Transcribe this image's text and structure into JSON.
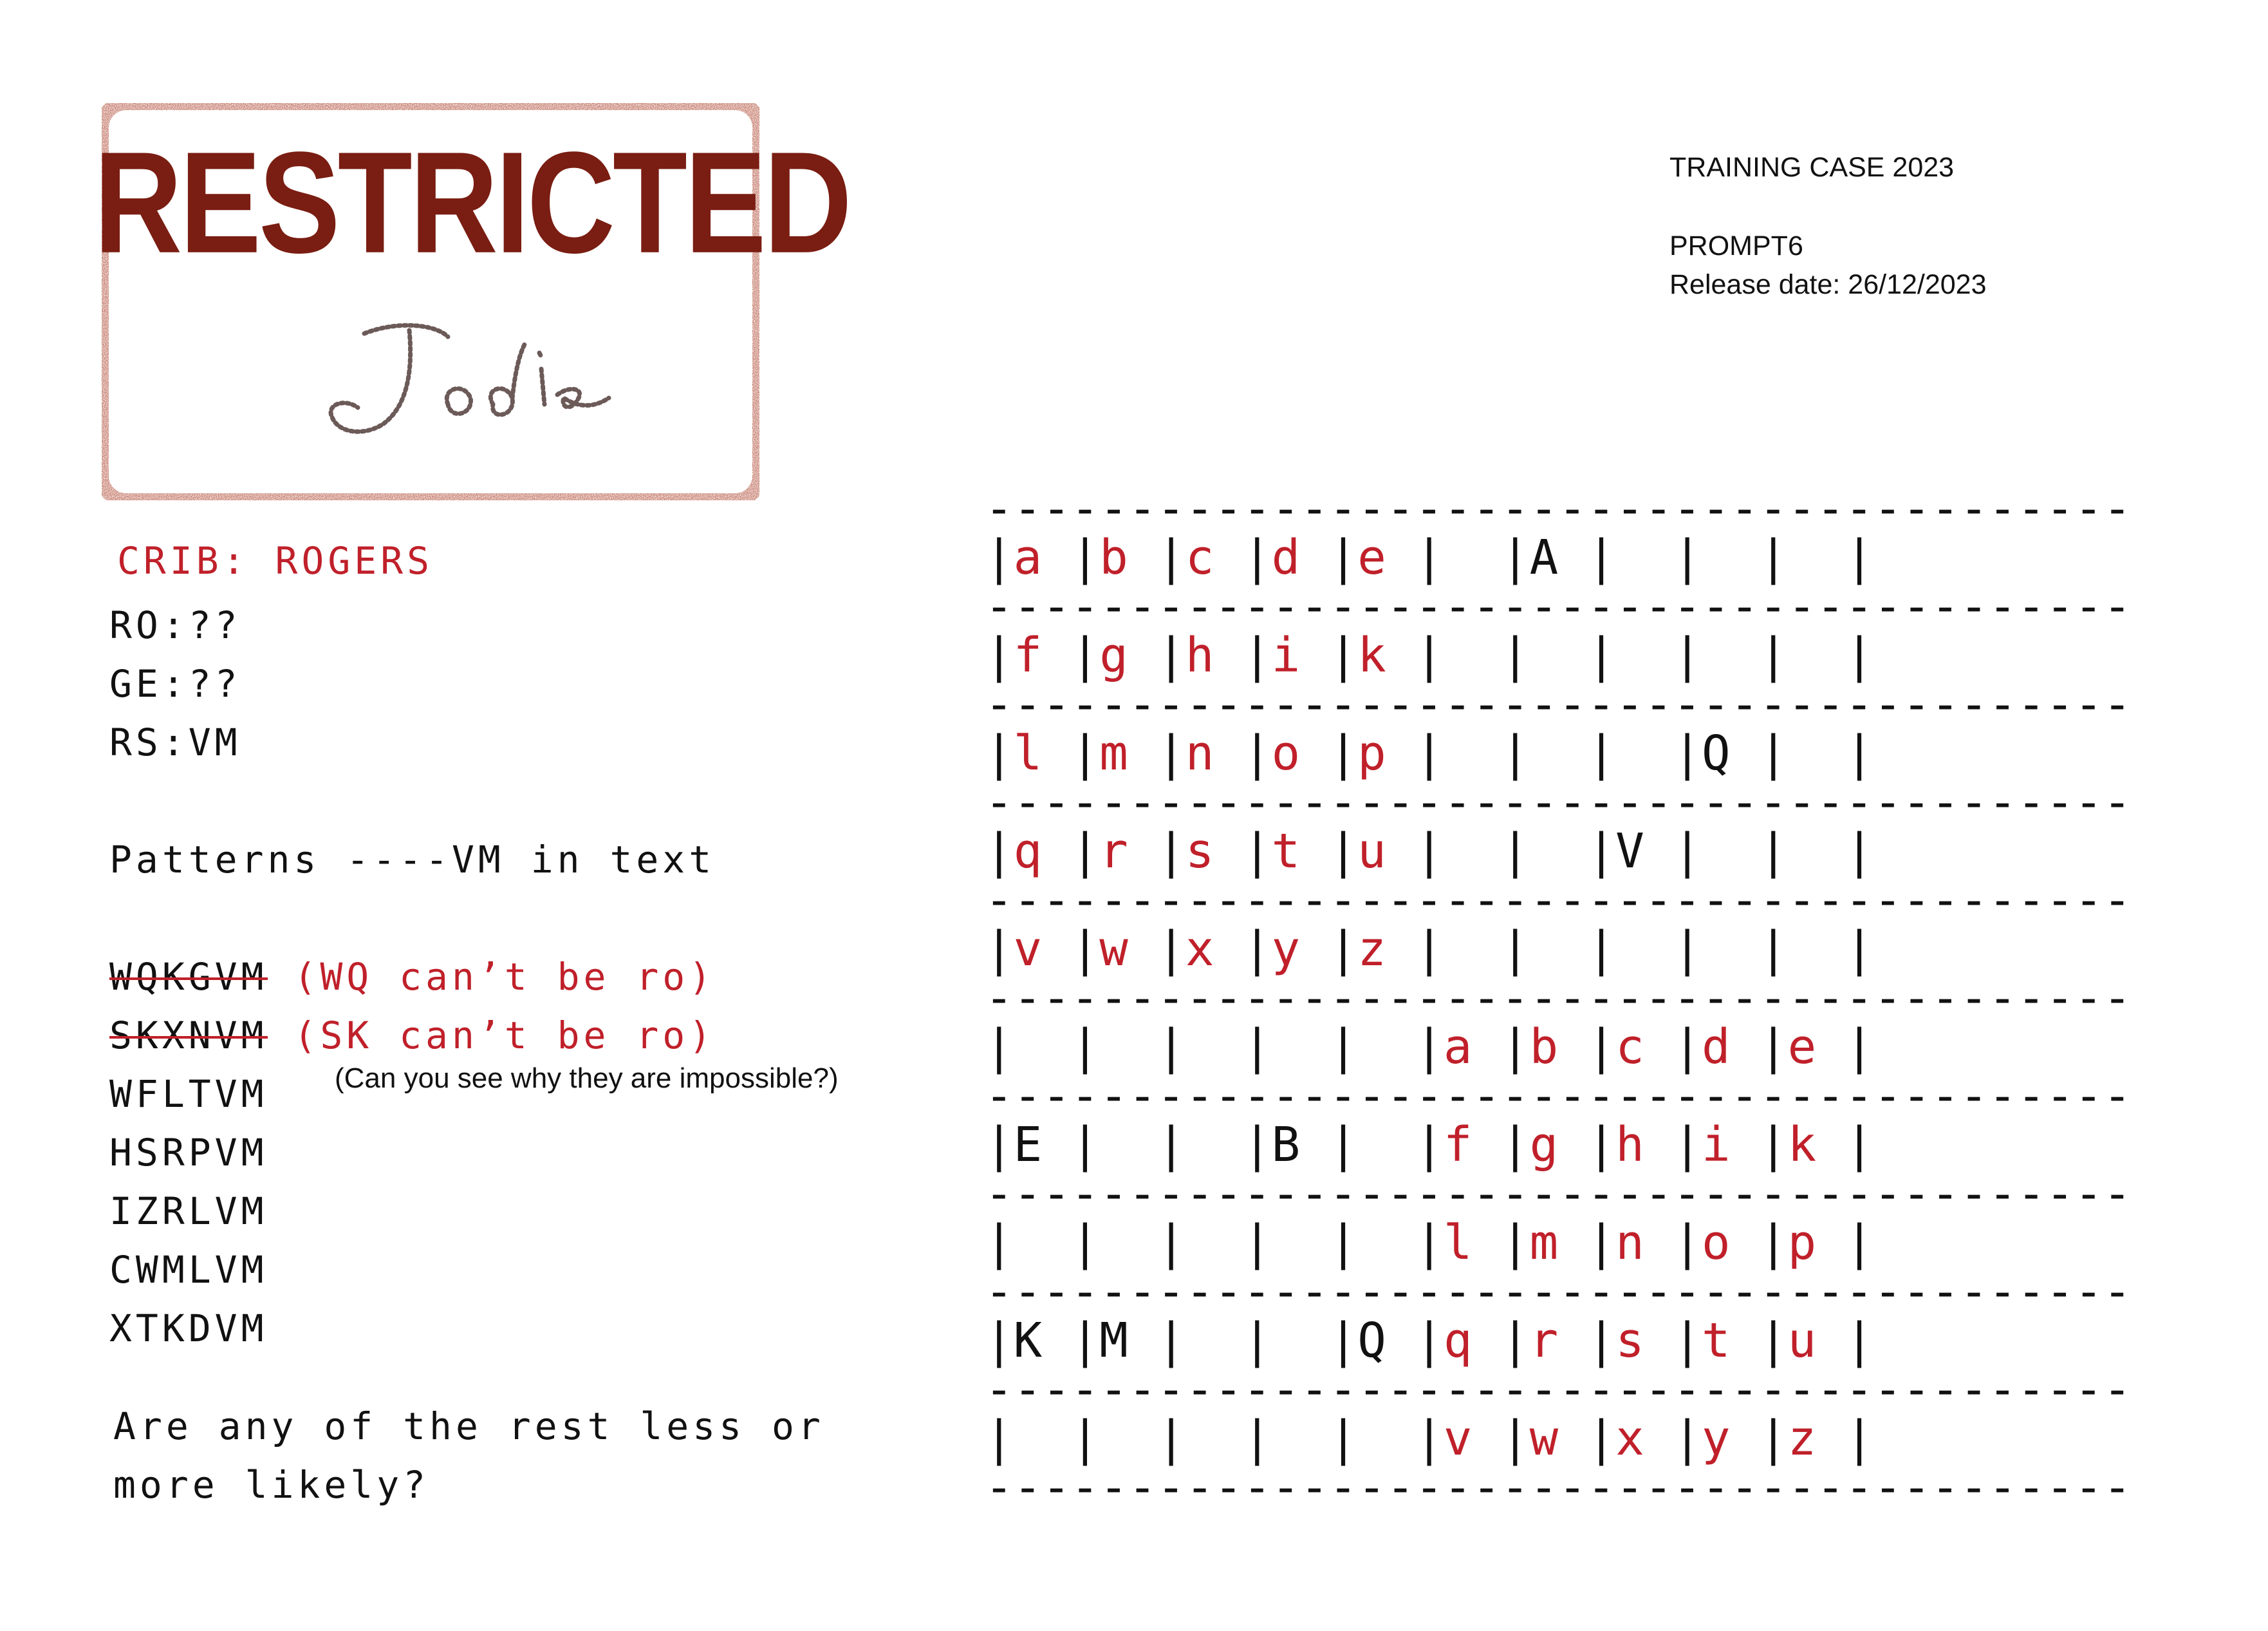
{
  "stamp": {
    "word": "RESTRICTED",
    "signature": "Jodie"
  },
  "header": {
    "case": "TRAINING CASE 2023",
    "prompt": "PROMPT6",
    "release": "Release date: 26/12/2023"
  },
  "notes": {
    "crib": "CRIB: ROGERS",
    "pairs": [
      "RO:??",
      "GE:??",
      "RS:VM"
    ],
    "patterns": "Patterns ----VM in text",
    "eliminated": [
      {
        "word": "WQKGVM",
        "reason": "(WQ can’t be ro)"
      },
      {
        "word": "SKXNVM",
        "reason": "(SK can’t be ro)"
      }
    ],
    "question_hint": "(Can you see why they are impossible?)",
    "candidates": [
      "WFLTVM",
      "HSRPVM",
      "IZRLVM",
      "CWMLVM",
      "XTKDVM"
    ],
    "closing_line1": "Are any of the rest less or",
    "closing_line2": "more likely?"
  },
  "grid": {
    "dash_line": "----------------------------------------",
    "rows": [
      [
        {
          "t": "a",
          "c": "red"
        },
        {
          "t": "b",
          "c": "red"
        },
        {
          "t": "c",
          "c": "red"
        },
        {
          "t": "d",
          "c": "red"
        },
        {
          "t": "e",
          "c": "red"
        },
        {
          "t": " ",
          "c": "black"
        },
        {
          "t": "A",
          "c": "black"
        },
        {
          "t": " ",
          "c": "black"
        },
        {
          "t": " ",
          "c": "black"
        },
        {
          "t": " ",
          "c": "black"
        }
      ],
      [
        {
          "t": "f",
          "c": "red"
        },
        {
          "t": "g",
          "c": "red"
        },
        {
          "t": "h",
          "c": "red"
        },
        {
          "t": "i",
          "c": "red"
        },
        {
          "t": "k",
          "c": "red"
        },
        {
          "t": " ",
          "c": "black"
        },
        {
          "t": " ",
          "c": "black"
        },
        {
          "t": " ",
          "c": "black"
        },
        {
          "t": " ",
          "c": "black"
        },
        {
          "t": " ",
          "c": "black"
        }
      ],
      [
        {
          "t": "l",
          "c": "red"
        },
        {
          "t": "m",
          "c": "red"
        },
        {
          "t": "n",
          "c": "red"
        },
        {
          "t": "o",
          "c": "red"
        },
        {
          "t": "p",
          "c": "red"
        },
        {
          "t": " ",
          "c": "black"
        },
        {
          "t": " ",
          "c": "black"
        },
        {
          "t": " ",
          "c": "black"
        },
        {
          "t": "Q",
          "c": "black"
        },
        {
          "t": " ",
          "c": "black"
        }
      ],
      [
        {
          "t": "q",
          "c": "red"
        },
        {
          "t": "r",
          "c": "red"
        },
        {
          "t": "s",
          "c": "red"
        },
        {
          "t": "t",
          "c": "red"
        },
        {
          "t": "u",
          "c": "red"
        },
        {
          "t": " ",
          "c": "black"
        },
        {
          "t": " ",
          "c": "black"
        },
        {
          "t": "V",
          "c": "black"
        },
        {
          "t": " ",
          "c": "black"
        },
        {
          "t": " ",
          "c": "black"
        }
      ],
      [
        {
          "t": "v",
          "c": "red"
        },
        {
          "t": "w",
          "c": "red"
        },
        {
          "t": "x",
          "c": "red"
        },
        {
          "t": "y",
          "c": "red"
        },
        {
          "t": "z",
          "c": "red"
        },
        {
          "t": " ",
          "c": "black"
        },
        {
          "t": " ",
          "c": "black"
        },
        {
          "t": " ",
          "c": "black"
        },
        {
          "t": " ",
          "c": "black"
        },
        {
          "t": " ",
          "c": "black"
        }
      ],
      [
        {
          "t": " ",
          "c": "black"
        },
        {
          "t": " ",
          "c": "black"
        },
        {
          "t": " ",
          "c": "black"
        },
        {
          "t": " ",
          "c": "black"
        },
        {
          "t": " ",
          "c": "black"
        },
        {
          "t": "a",
          "c": "red"
        },
        {
          "t": "b",
          "c": "red"
        },
        {
          "t": "c",
          "c": "red"
        },
        {
          "t": "d",
          "c": "red"
        },
        {
          "t": "e",
          "c": "red"
        }
      ],
      [
        {
          "t": "E",
          "c": "black"
        },
        {
          "t": " ",
          "c": "black"
        },
        {
          "t": " ",
          "c": "black"
        },
        {
          "t": "B",
          "c": "black"
        },
        {
          "t": " ",
          "c": "black"
        },
        {
          "t": "f",
          "c": "red"
        },
        {
          "t": "g",
          "c": "red"
        },
        {
          "t": "h",
          "c": "red"
        },
        {
          "t": "i",
          "c": "red"
        },
        {
          "t": "k",
          "c": "red"
        }
      ],
      [
        {
          "t": " ",
          "c": "black"
        },
        {
          "t": " ",
          "c": "black"
        },
        {
          "t": " ",
          "c": "black"
        },
        {
          "t": " ",
          "c": "black"
        },
        {
          "t": " ",
          "c": "black"
        },
        {
          "t": "l",
          "c": "red"
        },
        {
          "t": "m",
          "c": "red"
        },
        {
          "t": "n",
          "c": "red"
        },
        {
          "t": "o",
          "c": "red"
        },
        {
          "t": "p",
          "c": "red"
        }
      ],
      [
        {
          "t": "K",
          "c": "black"
        },
        {
          "t": "M",
          "c": "black"
        },
        {
          "t": " ",
          "c": "black"
        },
        {
          "t": " ",
          "c": "black"
        },
        {
          "t": "Q",
          "c": "black"
        },
        {
          "t": "q",
          "c": "red"
        },
        {
          "t": "r",
          "c": "red"
        },
        {
          "t": "s",
          "c": "red"
        },
        {
          "t": "t",
          "c": "red"
        },
        {
          "t": "u",
          "c": "red"
        }
      ],
      [
        {
          "t": " ",
          "c": "black"
        },
        {
          "t": " ",
          "c": "black"
        },
        {
          "t": " ",
          "c": "black"
        },
        {
          "t": " ",
          "c": "black"
        },
        {
          "t": " ",
          "c": "black"
        },
        {
          "t": "v",
          "c": "red"
        },
        {
          "t": "w",
          "c": "red"
        },
        {
          "t": "x",
          "c": "red"
        },
        {
          "t": "y",
          "c": "red"
        },
        {
          "t": "z",
          "c": "red"
        }
      ]
    ]
  },
  "colors": {
    "accent_red": "#c0202a",
    "stamp_red": "#7a1d12",
    "text": "#111111"
  }
}
